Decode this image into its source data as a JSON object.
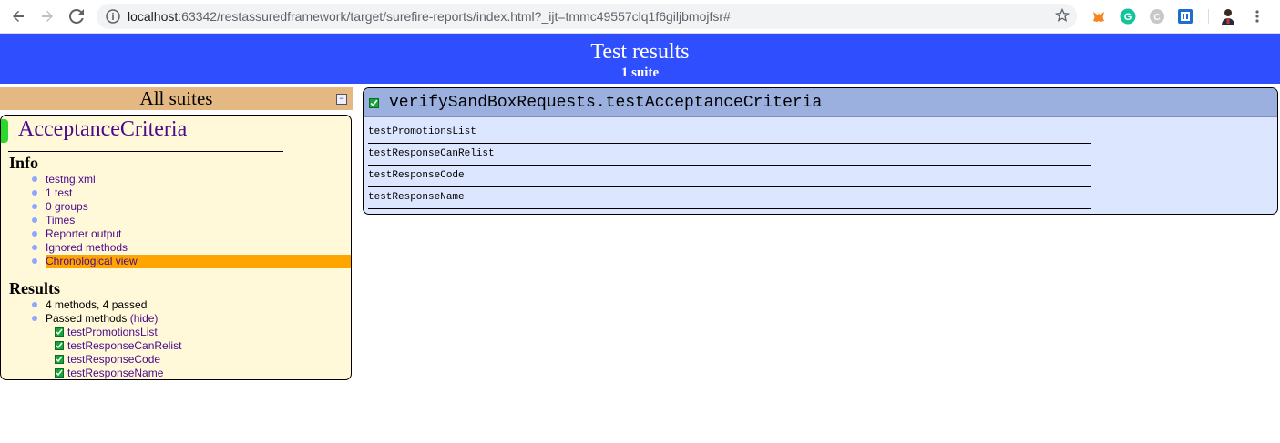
{
  "browser": {
    "url_host": "localhost",
    "url_rest": ":63342/restassuredframework/target/surefire-reports/index.html?_ijt=tmmc49557clq1f6giljbmojfsr#"
  },
  "banner": {
    "title": "Test results",
    "subtitle": "1 suite"
  },
  "navigator": {
    "header": "All suites",
    "collapse_symbol": "−",
    "suite_name": "AcceptanceCriteria",
    "info_title": "Info",
    "info_items": [
      "testng.xml",
      "1 test",
      "0 groups",
      "Times",
      "Reporter output",
      "Ignored methods",
      "Chronological view"
    ],
    "highlighted_info_item": "Chronological view",
    "results_title": "Results",
    "summary": "4 methods, 4 passed",
    "passed_label": "Passed methods",
    "hide_link": "(hide)",
    "passed_methods": [
      "testPromotionsList",
      "testResponseCanRelist",
      "testResponseCode",
      "testResponseName"
    ]
  },
  "main_panel": {
    "title": "verifySandBoxRequests.testAcceptanceCriteria",
    "methods": [
      "testPromotionsList",
      "testResponseCanRelist",
      "testResponseCode",
      "testResponseName"
    ]
  },
  "colors": {
    "banner": "#2f4fff",
    "suite_header": "#e4b883",
    "suite_box": "#fff8d9",
    "highlight": "#ffa500",
    "panel_header": "#9bb0de",
    "panel_body": "#dce6ff",
    "pass_green": "#17a43a"
  },
  "icons": [
    "back-arrow-icon",
    "forward-arrow-icon",
    "reload-icon",
    "info-icon",
    "star-icon",
    "metamask-icon",
    "grammarly-icon",
    "extension-c-icon",
    "instapaper-icon",
    "profile-avatar",
    "more-menu-icon"
  ]
}
